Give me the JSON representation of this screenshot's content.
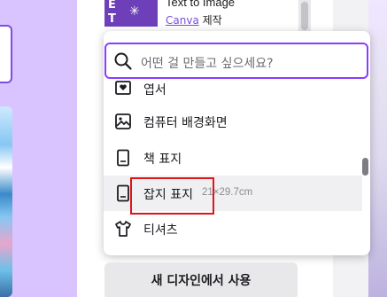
{
  "template": {
    "title": "Text to Image",
    "brand": "Canva",
    "made_by": "제작"
  },
  "search": {
    "placeholder": "어떤 걸 만들고 싶으세요?"
  },
  "menu": {
    "items": [
      {
        "label": "엽서",
        "icon": "postcard-icon"
      },
      {
        "label": "컴퓨터 배경화면",
        "icon": "image-icon"
      },
      {
        "label": "책 표지",
        "icon": "book-icon"
      },
      {
        "label": "잡지 표지",
        "size": "21×29.7cm",
        "icon": "magazine-icon"
      },
      {
        "label": "티셔츠",
        "icon": "tshirt-icon"
      }
    ]
  },
  "actions": {
    "use_in_new_design": "새 디자인에서 사용"
  },
  "colors": {
    "accent": "#8b3dff",
    "highlight_box": "#e0151a",
    "left_bg": "#d9c4ff"
  }
}
